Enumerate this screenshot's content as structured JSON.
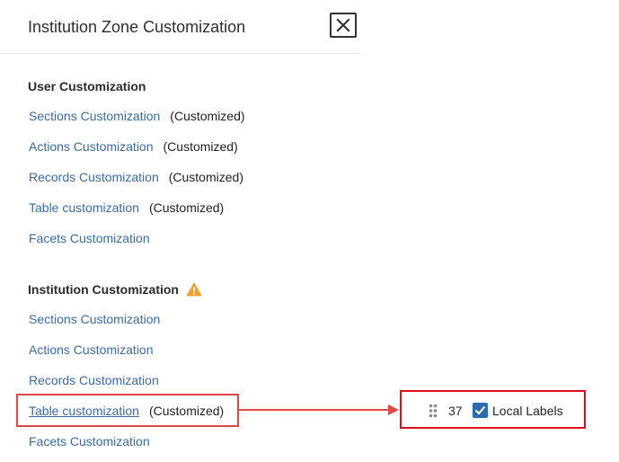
{
  "panel": {
    "title": "Institution Zone Customization"
  },
  "user_customization": {
    "heading": "User Customization",
    "items": [
      {
        "label": "Sections Customization",
        "status": "(Customized)"
      },
      {
        "label": "Actions Customization",
        "status": "(Customized)"
      },
      {
        "label": "Records Customization",
        "status": "(Customized)"
      },
      {
        "label": "Table customization",
        "status": "(Customized)"
      },
      {
        "label": "Facets Customization",
        "status": ""
      }
    ]
  },
  "institution_customization": {
    "heading": "Institution Customization",
    "warning_icon": "warning-icon",
    "items": [
      {
        "label": "Sections Customization",
        "status": ""
      },
      {
        "label": "Actions Customization",
        "status": ""
      },
      {
        "label": "Records Customization",
        "status": ""
      },
      {
        "label": "Table customization",
        "status": "(Customized)"
      },
      {
        "label": "Facets Customization",
        "status": ""
      }
    ]
  },
  "column_row": {
    "count": "37",
    "checked": true,
    "label": "Local Labels"
  },
  "colors": {
    "link": "#3b6aa3",
    "highlight": "#e04848",
    "callout": "#e00d1d",
    "checkbox": "#2b6cb0",
    "warning": "#f0a030"
  }
}
